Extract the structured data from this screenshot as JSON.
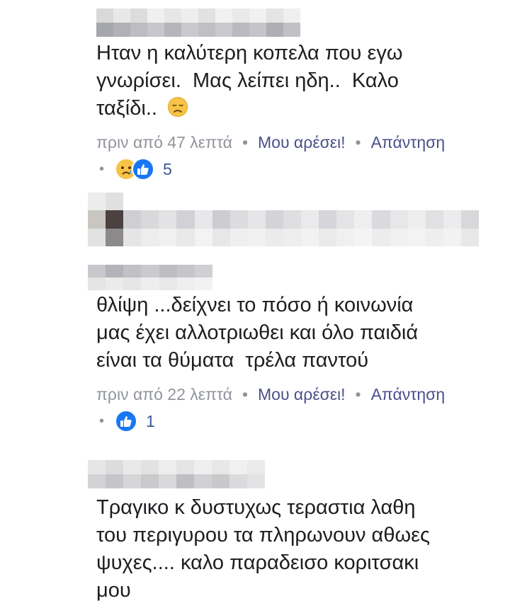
{
  "comments": [
    {
      "text": "Ηταν η καλύτερη κοπελα που εγω\nγνωρίσει.  Μας λείπει ηδη..  Καλο\nταξίδι.. ",
      "time": "πριν από 47 λεπτά",
      "like_label": "Μου αρέσει!",
      "reply_label": "Απάντηση",
      "reaction_count": "5",
      "reactions": [
        "sad-face",
        "like-thumb"
      ],
      "inline_emoji": "disappointed-face"
    },
    {
      "text": "θλίψη ...δείχνει το πόσο ή κοινωνία\nμας έχει αλλοτριωθει και όλο παιδιά\nείναι τα θύματα  τρέλα παντού",
      "time": "πριν από 22 λεπτά",
      "like_label": "Μου αρέσει!",
      "reply_label": "Απάντηση",
      "reaction_count": "1",
      "reactions": [
        "like-thumb"
      ]
    },
    {
      "text": "Τραγικο κ δυστυχως τεραστια λαθη\nτου περιγυρου τα πληρωνουν αθωες\nψυχες.... καλο παραδεισο κοριτσακι\nμου"
    }
  ],
  "separator": "•",
  "colors": {
    "text": "#1c1e21",
    "meta": "#90949c",
    "link": "#4b4f8a",
    "count": "#3b5998",
    "like_blue": "#1877f2",
    "sad_yellow": "#f7c348"
  }
}
